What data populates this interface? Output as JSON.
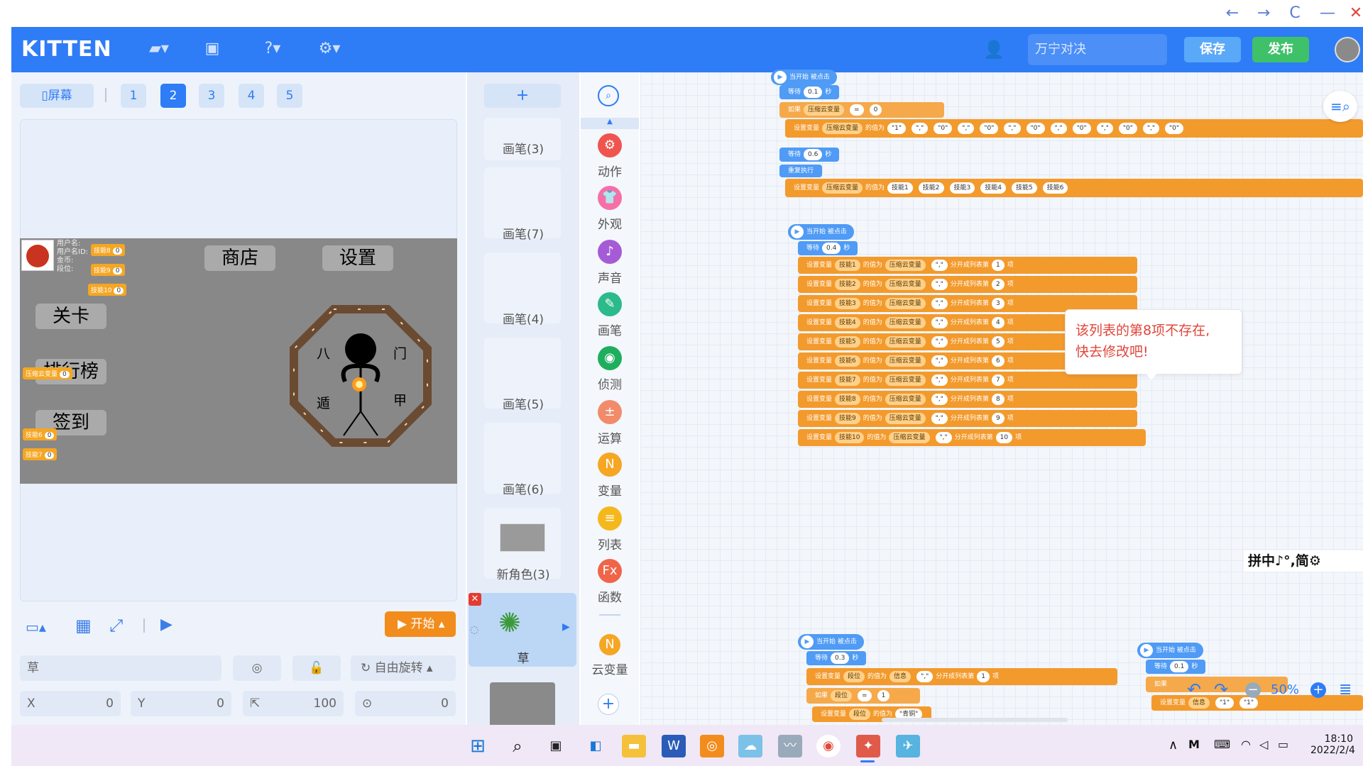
{
  "window": {
    "back": "←",
    "forward": "→",
    "refresh": "C",
    "minimize": "—",
    "close": "✕"
  },
  "header": {
    "logo": "KITTEN",
    "room_name": "万宁对决",
    "save_label": "保存",
    "publish_label": "发布"
  },
  "screens": {
    "toggle_label": "▯屏幕",
    "items": [
      "1",
      "2",
      "3",
      "4",
      "5"
    ],
    "active": "2"
  },
  "stage": {
    "buttons": {
      "shop": "商店",
      "settings": "设置",
      "level": "关卡",
      "rank": "排行榜",
      "checkin": "签到"
    },
    "profile_lines": [
      "用户名:",
      "用户名ID:",
      "金币:",
      "段位:"
    ],
    "monitors": [
      {
        "label": "技能8",
        "value": "0"
      },
      {
        "label": "技能9",
        "value": "0"
      },
      {
        "label": "技能10",
        "value": "0"
      },
      {
        "label": "压缩云变量",
        "value": "0"
      },
      {
        "label": "技能6",
        "value": "0"
      },
      {
        "label": "技能7",
        "value": "0"
      }
    ],
    "bagua": [
      "八",
      "门",
      "遁",
      "甲"
    ]
  },
  "controls": {
    "start": "开始",
    "sprite_name": "草",
    "rotation": "自由旋转",
    "x_label": "X",
    "x": "0",
    "y_label": "Y",
    "y": "0",
    "size": "100",
    "direction": "0"
  },
  "sprites": {
    "add": "+",
    "items": [
      "画笔(3)",
      "画笔(7)",
      "画笔(4)",
      "画笔(5)",
      "画笔(6)",
      "新角色(3)",
      "草"
    ],
    "selected": "草"
  },
  "categories": [
    "动作",
    "外观",
    "声音",
    "画笔",
    "侦测",
    "运算",
    "变量",
    "列表",
    "函数",
    "云变量"
  ],
  "code": {
    "hat_label": "当开始 被点击",
    "wait": "等待",
    "seconds": "秒",
    "if": "如果",
    "repeat": "重复执行",
    "set_var": "设置变量",
    "value_of": "的值为",
    "split": "分开成列表",
    "item": "第",
    "item_suffix": "项",
    "compressed_var": "压缩云变量",
    "eq": "=",
    "block1": {
      "waits": [
        "0.1",
        "0.6"
      ],
      "eq_value": "0",
      "join_values": [
        "\"1\"",
        "\",\"",
        "\"0\"",
        "\",\"",
        "\"0\"",
        "\",\"",
        "\"0\"",
        "\",\"",
        "\"0\"",
        "\",\"",
        "\"0\"",
        "\",\"",
        "\"0\"",
        "\",\"",
        "\"0\""
      ],
      "skills": [
        "技能1",
        "技能2",
        "技能3",
        "技能4",
        "技能5",
        "技能6"
      ]
    },
    "block2": {
      "wait": "0.4",
      "rows": [
        {
          "var": "技能1",
          "n": "1"
        },
        {
          "var": "技能2",
          "n": "2"
        },
        {
          "var": "技能3",
          "n": "3"
        },
        {
          "var": "技能4",
          "n": "4"
        },
        {
          "var": "技能5",
          "n": "5"
        },
        {
          "var": "技能6",
          "n": "6"
        },
        {
          "var": "技能7",
          "n": "7"
        },
        {
          "var": "技能8",
          "n": "8"
        },
        {
          "var": "技能9",
          "n": "9"
        },
        {
          "var": "技能10",
          "n": "10"
        }
      ]
    },
    "block3": {
      "wait": "0.3",
      "var": "段位",
      "source": "信息",
      "n": "1",
      "eq_value": "1",
      "rank_value": "\"青铜\""
    },
    "block4": {
      "wait": "0.1",
      "source": "信息",
      "values": [
        "\"1\"",
        "\"1\""
      ]
    },
    "zoom": "50%"
  },
  "tooltip": {
    "line1": "该列表的第8项不存在,",
    "line2": "快去修改吧!"
  },
  "ime": "拼中♪°,简⚙",
  "taskbar": {
    "time": "18:10",
    "date": "2022/2/4"
  }
}
